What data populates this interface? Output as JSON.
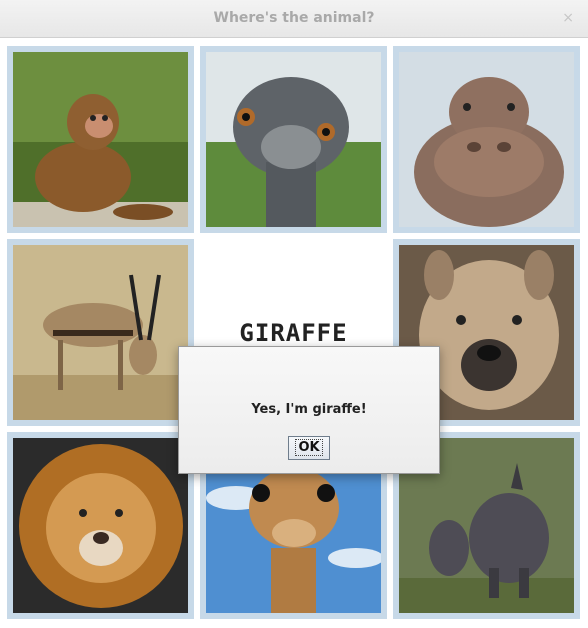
{
  "window": {
    "title": "Where's the animal?",
    "close_glyph": "×"
  },
  "board": {
    "center_label": "GIRAFFE",
    "tiles": [
      {
        "animal": "monkey",
        "icon": "monkey-icon",
        "colors": [
          "#6b8a3c",
          "#8b5a2b"
        ]
      },
      {
        "animal": "emu",
        "icon": "emu-icon",
        "colors": [
          "#a7b3a0",
          "#5f6468"
        ]
      },
      {
        "animal": "hippo",
        "icon": "hippo-icon",
        "colors": [
          "#cfd9e0",
          "#8a6d5e"
        ]
      },
      {
        "animal": "gazelle",
        "icon": "gazelle-icon",
        "colors": [
          "#b8a57a",
          "#a58863"
        ]
      },
      {
        "animal": "hyena",
        "icon": "hyena-icon",
        "colors": [
          "#8e7a64",
          "#c2a98a"
        ]
      },
      {
        "animal": "lion",
        "icon": "lion-icon",
        "colors": [
          "#2a2a2a",
          "#c8862f"
        ]
      },
      {
        "animal": "giraffe",
        "icon": "giraffe-icon",
        "colors": [
          "#4f8fd1",
          "#b07b42"
        ]
      },
      {
        "animal": "rhino",
        "icon": "rhino-icon",
        "colors": [
          "#5a6a4a",
          "#4e4c55"
        ]
      }
    ]
  },
  "dialog": {
    "message": "Yes, I'm giraffe!",
    "ok_label": "OK"
  }
}
